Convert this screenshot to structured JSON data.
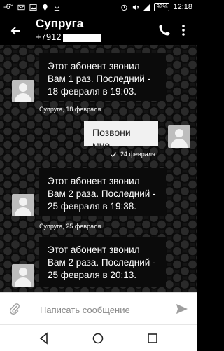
{
  "status_bar": {
    "temperature": "-6°",
    "battery": "97%",
    "time": "12:18"
  },
  "app_bar": {
    "title": "Супруга",
    "subtitle": "+7912"
  },
  "messages": [
    {
      "type": "in",
      "text": "Этот абонент звонил Вам 1 раз. Последний - 18 февраля в 19:03.",
      "meta": "Супруга, 18 февраля"
    },
    {
      "type": "out",
      "text": "Позвони мне",
      "meta": "24 февраля"
    },
    {
      "type": "in",
      "text": "Этот абонент звонил Вам 2 раза. Последний - 25 февраля в 19:38.",
      "meta": "Супруга, 25 февраля"
    },
    {
      "type": "in",
      "text": "Этот абонент звонил Вам 2 раза. Последний - 25 февраля в 20:13.",
      "meta": ""
    }
  ],
  "composer": {
    "placeholder": "Написать сообщение"
  },
  "icons": {
    "back": "arrow-left-icon",
    "call": "phone-icon",
    "more": "more-vert-icon",
    "attach": "paperclip-icon",
    "send": "send-icon"
  },
  "colors": {
    "background": "#000000",
    "bubble_out": "#f1f1f1",
    "bubble_in": "#0b0b0b"
  }
}
